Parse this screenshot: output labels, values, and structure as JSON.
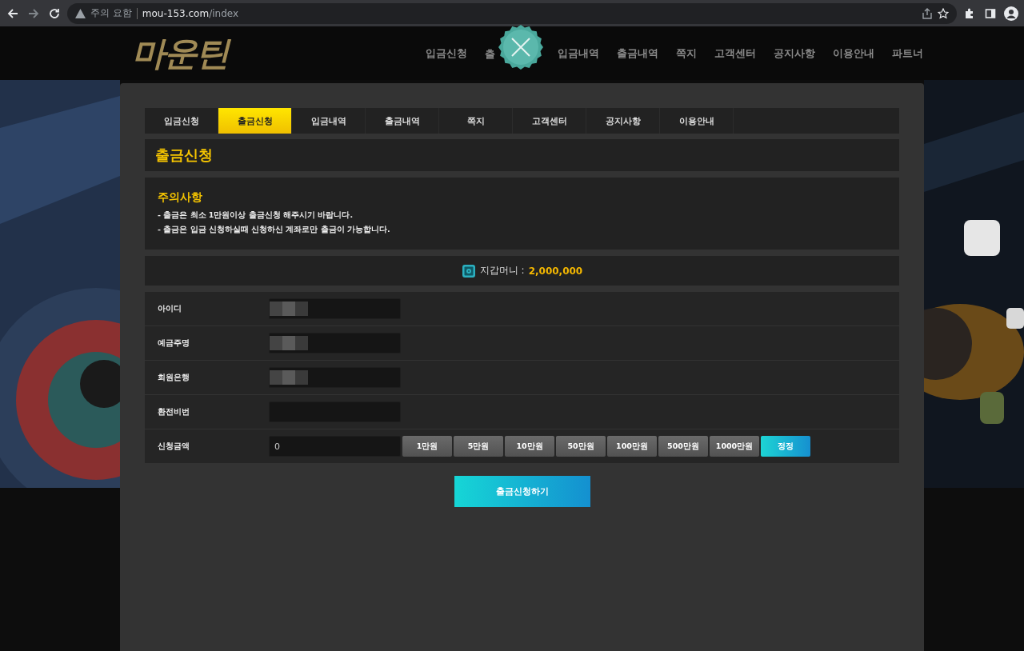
{
  "browser": {
    "security_label": "주의 요함",
    "url_host": "mou-153.com",
    "url_path": "/index"
  },
  "site_header": {
    "logo": "마운틴",
    "nav": [
      "입금신청",
      "출",
      "입금내역",
      "출금내역",
      "쪽지",
      "고객센터",
      "공지사항",
      "이용안내",
      "파트너"
    ]
  },
  "tabs": [
    {
      "label": "입금신청",
      "selected": false
    },
    {
      "label": "출금신청",
      "selected": true
    },
    {
      "label": "입금내역",
      "selected": false
    },
    {
      "label": "출금내역",
      "selected": false
    },
    {
      "label": "쪽지",
      "selected": false
    },
    {
      "label": "고객센터",
      "selected": false
    },
    {
      "label": "공지사항",
      "selected": false
    },
    {
      "label": "이용안내",
      "selected": false
    }
  ],
  "page_title": "출금신청",
  "notice": {
    "title": "주의사항",
    "lines": [
      "- 출금은 최소 1만원이상 출금신청 해주시기 바랍니다.",
      "- 출금은 입금 신청하실때 신청하신 계좌로만 출금이 가능합니다."
    ]
  },
  "wallet": {
    "label": "지갑머니 :",
    "amount": "2,000,000"
  },
  "form": [
    {
      "label": "아이디",
      "kind": "redacted"
    },
    {
      "label": "예금주명",
      "kind": "redacted"
    },
    {
      "label": "회원은행",
      "kind": "redacted"
    },
    {
      "label": "환전비번",
      "kind": "password"
    },
    {
      "label": "신청금액",
      "kind": "amount",
      "value": "0"
    }
  ],
  "amount_buttons": [
    {
      "label": "1만원",
      "kind": "preset"
    },
    {
      "label": "5만원",
      "kind": "preset"
    },
    {
      "label": "10만원",
      "kind": "preset"
    },
    {
      "label": "50만원",
      "kind": "preset"
    },
    {
      "label": "100만원",
      "kind": "preset"
    },
    {
      "label": "500만원",
      "kind": "preset"
    },
    {
      "label": "1000만원",
      "kind": "preset"
    },
    {
      "label": "정정",
      "kind": "reset"
    }
  ],
  "submit": "출금신청하기"
}
